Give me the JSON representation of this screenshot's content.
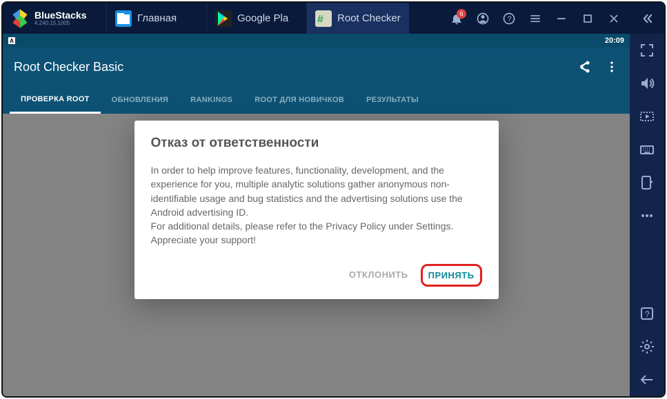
{
  "branding": {
    "name": "BlueStacks",
    "version": "4.240.15.1005"
  },
  "tabs": [
    {
      "label": "Главная"
    },
    {
      "label": "Google Pla"
    },
    {
      "label": "Root Checker"
    }
  ],
  "notification_badge": "6",
  "status_bar": {
    "indicator": "A",
    "time": "20:09"
  },
  "app": {
    "title": "Root Checker Basic",
    "nav": [
      "ПРОВЕРКА ROOT",
      "ОБНОВЛЕНИЯ",
      "RANKINGS",
      "ROOT ДЛЯ НОВИЧКОВ",
      "РЕЗУЛЬТАТЫ"
    ]
  },
  "dialog": {
    "title": "Отказ от ответственности",
    "para1": "In order to help improve features, functionality, development, and the experience for you, multiple analytic solutions gather anonymous non-identifiable usage and bug statistics and the advertising solutions use the Android advertising ID.",
    "para2": "For additional details, please refer to the Privacy Policy under Settings.",
    "para3": "Appreciate your support!",
    "decline": "ОТКЛОНИТЬ",
    "accept": "ПРИНЯТЬ"
  }
}
